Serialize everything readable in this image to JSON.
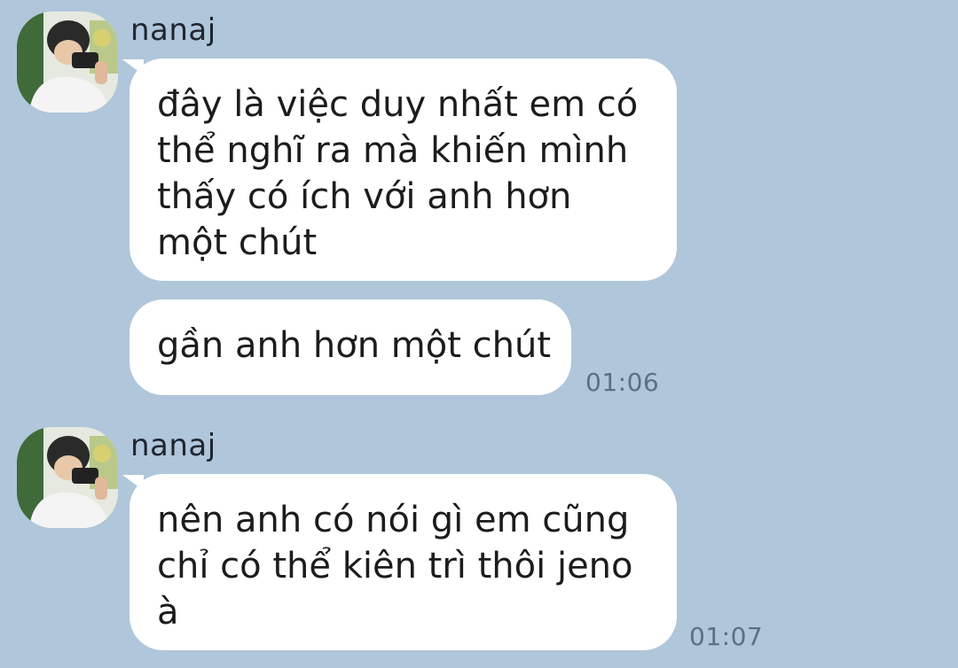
{
  "messages": [
    {
      "sender": "nanaj",
      "avatar_icon": "user-photo-avatar",
      "text": "đây là việc duy nhất em có thể nghĩ ra mà khiến mình thấy có ích với anh hơn một chút"
    },
    {
      "text": "gần anh hơn một chút",
      "time": "01:06"
    },
    {
      "sender": "nanaj",
      "avatar_icon": "user-photo-avatar",
      "text": "nên anh có nói gì em cũng chỉ có thể kiên trì thôi jeno à",
      "time": "01:07"
    }
  ],
  "colors": {
    "background": "#b0c6da",
    "bubble": "#ffffff",
    "timestamp": "#5f6f80"
  }
}
